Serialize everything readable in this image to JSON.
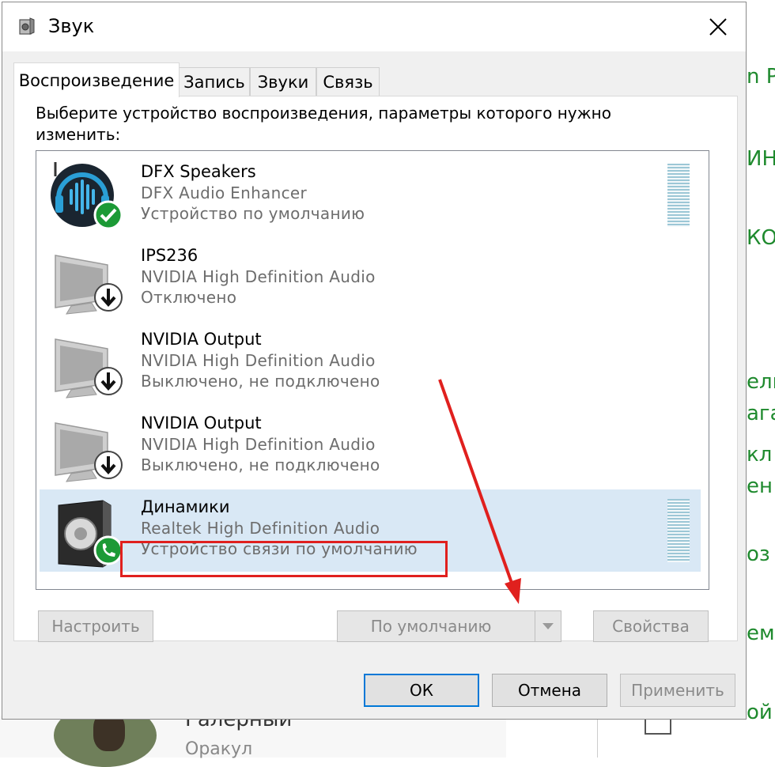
{
  "background": {
    "right_fragments": [
      "n P",
      "ИН",
      "КОВ",
      "ель",
      "ага",
      "кл",
      "ен",
      "оз",
      "ем",
      "ой"
    ],
    "bottom_name": "Галерный",
    "bottom_sub": "Оракул"
  },
  "dialog": {
    "title": "Звук",
    "tabs": [
      {
        "label": "Воспроизведение",
        "active": true
      },
      {
        "label": "Запись",
        "active": false
      },
      {
        "label": "Звуки",
        "active": false
      },
      {
        "label": "Связь",
        "active": false
      }
    ],
    "instruction": "Выберите устройство воспроизведения, параметры которого нужно изменить:",
    "devices": [
      {
        "name": "DFX Speakers",
        "driver": "DFX Audio Enhancer",
        "status": "Устройство по умолчанию",
        "icon": "dfx-headphones-icon",
        "badge": "green-check",
        "meter": true,
        "selected": false
      },
      {
        "name": "IPS236",
        "driver": "NVIDIA High Definition Audio",
        "status": "Отключено",
        "icon": "monitor-icon",
        "badge": "down-arrow",
        "meter": false,
        "selected": false
      },
      {
        "name": "NVIDIA Output",
        "driver": "NVIDIA High Definition Audio",
        "status": "Выключено, не подключено",
        "icon": "monitor-icon",
        "badge": "down-arrow",
        "meter": false,
        "selected": false
      },
      {
        "name": "NVIDIA Output",
        "driver": "NVIDIA High Definition Audio",
        "status": "Выключено, не подключено",
        "icon": "monitor-icon",
        "badge": "down-arrow",
        "meter": false,
        "selected": false
      },
      {
        "name": "Динамики",
        "driver": "Realtek High Definition Audio",
        "status": "Устройство связи по умолчанию",
        "icon": "speaker-icon",
        "badge": "green-phone",
        "meter": true,
        "selected": true
      }
    ],
    "buttons": {
      "configure": "Настроить",
      "set_default": "По умолчанию",
      "properties": "Свойства",
      "ok": "ОК",
      "cancel": "Отмена",
      "apply": "Применить"
    }
  },
  "colors": {
    "accent": "#0078d7",
    "annotation_red": "#e0201e",
    "selection": "#d9e8f5",
    "background_text_green": "#1f8a2e"
  }
}
